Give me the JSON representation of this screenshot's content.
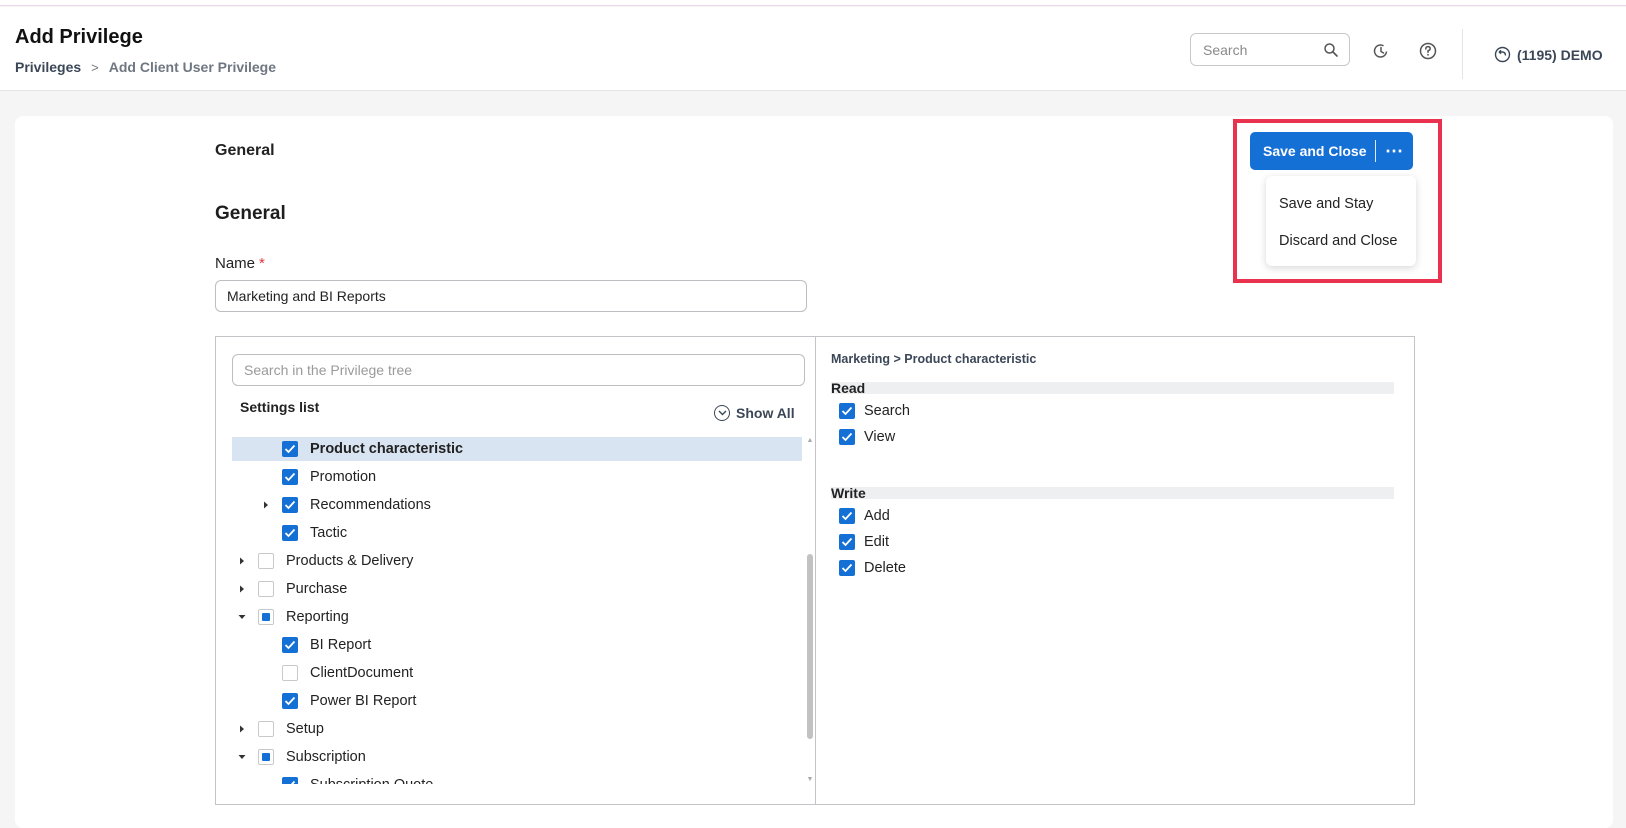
{
  "header": {
    "title": "Add Privilege",
    "breadcrumb": {
      "parent": "Privileges",
      "separator": ">",
      "current": "Add Client User Privilege"
    },
    "search_placeholder": "Search",
    "account": "(1195) DEMO"
  },
  "form": {
    "section_tab": "General",
    "section_heading": "General",
    "name_label": "Name",
    "required_mark": "*",
    "name_value": "Marketing and BI Reports"
  },
  "actions": {
    "save_close": "Save and Close",
    "more": "⋯",
    "menu": [
      "Save and Stay",
      "Discard and Close"
    ]
  },
  "tree": {
    "search_placeholder": "Search in the Privilege tree",
    "settings_title": "Settings list",
    "show_all": "Show All",
    "items": [
      {
        "label": "Product characteristic",
        "state": "checked",
        "selected": true,
        "expand": ""
      },
      {
        "label": "Promotion",
        "state": "checked",
        "selected": false,
        "expand": ""
      },
      {
        "label": "Recommendations",
        "state": "checked",
        "selected": false,
        "expand": "collapsed"
      },
      {
        "label": "Tactic",
        "state": "checked",
        "selected": false,
        "expand": ""
      },
      {
        "label": "Products & Delivery",
        "state": "empty",
        "selected": false,
        "expand": "collapsed"
      },
      {
        "label": "Purchase",
        "state": "empty",
        "selected": false,
        "expand": "collapsed"
      },
      {
        "label": "Reporting",
        "state": "partial",
        "selected": false,
        "expand": "expanded"
      },
      {
        "label": "BI Report",
        "state": "checked",
        "selected": false,
        "expand": ""
      },
      {
        "label": "ClientDocument",
        "state": "empty",
        "selected": false,
        "expand": ""
      },
      {
        "label": "Power BI Report",
        "state": "checked",
        "selected": false,
        "expand": ""
      },
      {
        "label": "Setup",
        "state": "empty",
        "selected": false,
        "expand": "collapsed"
      },
      {
        "label": "Subscription",
        "state": "partial",
        "selected": false,
        "expand": "expanded"
      },
      {
        "label": "Subscription Quote",
        "state": "checked",
        "selected": false,
        "expand": ""
      }
    ]
  },
  "permissions": {
    "breadcrumb": "Marketing > Product characteristic",
    "groups": [
      {
        "title": "Read",
        "items": [
          "Search",
          "View"
        ]
      },
      {
        "title": "Write",
        "items": [
          "Add",
          "Edit",
          "Delete"
        ]
      }
    ]
  },
  "colors": {
    "accent": "#1570d6",
    "highlight": "#e8324e",
    "selected_row": "#d9e4f2"
  }
}
